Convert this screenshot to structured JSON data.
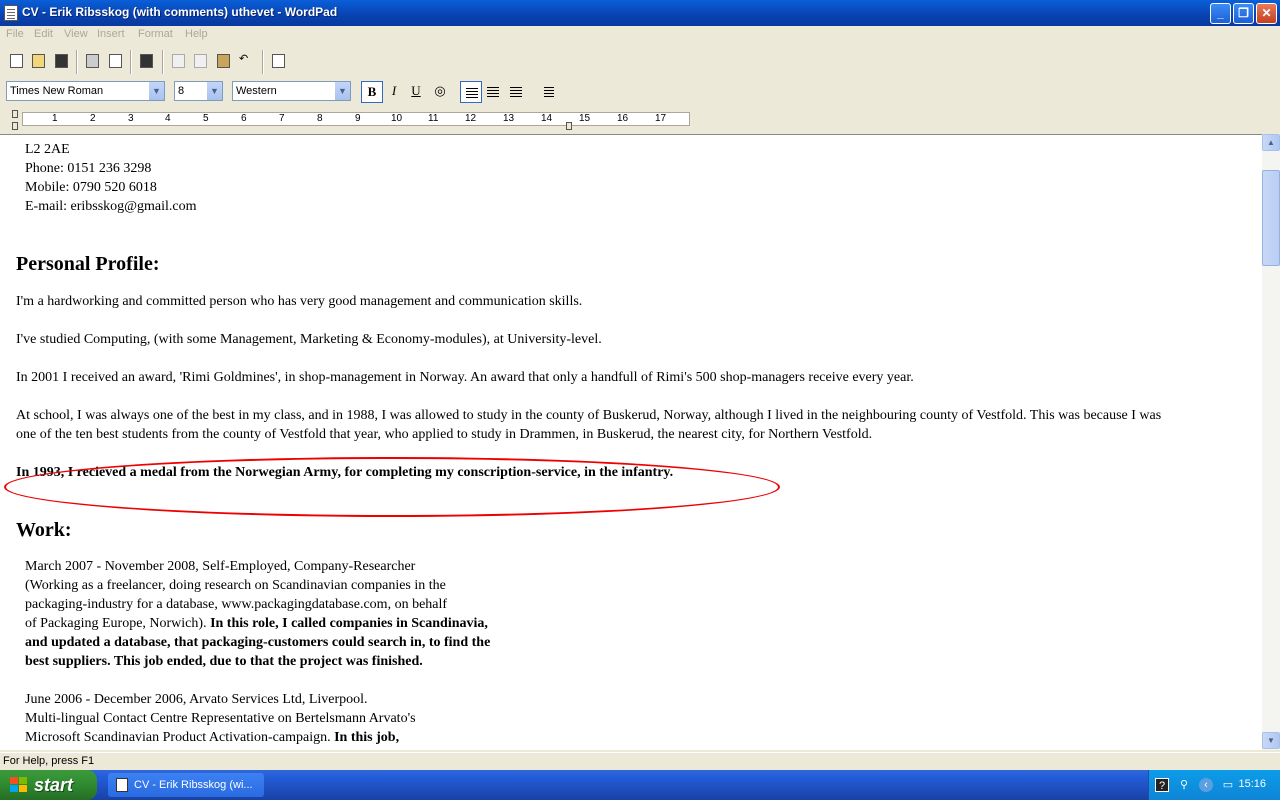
{
  "window": {
    "title": "CV - Erik Ribsskog (with comments) uthevet - WordPad"
  },
  "menu": [
    "File",
    "Edit",
    "View",
    "Insert",
    "Format",
    "Help"
  ],
  "format": {
    "font": "Times New Roman",
    "size": "8",
    "script": "Western",
    "bold_label": "B",
    "italic_label": "I",
    "underline_label": "U"
  },
  "ruler": [
    "1",
    "2",
    "3",
    "4",
    "5",
    "6",
    "7",
    "8",
    "9",
    "10",
    "11",
    "12",
    "13",
    "14",
    "15",
    "16",
    "17"
  ],
  "document": {
    "address_lines": [
      "L2 2AE",
      "Phone: 0151 236 3298",
      "Mobile: 0790 520 6018",
      "E-mail: eribsskog@gmail.com"
    ],
    "profile_heading": "Personal Profile:",
    "profile_p1": "I'm a hardworking and committed person who has very good management and communication skills.",
    "profile_p2": "I've studied Computing, (with some Management, Marketing & Economy-modules), at University-level.",
    "profile_p3": "In 2001 I received an award, 'Rimi Goldmines',  in shop-management in Norway. An award that only a handfull of Rimi's 500 shop-managers receive every year.",
    "profile_p4a": "At school, I was always one of the best in my class, and in 1988, I was allowed to study in the county of Buskerud, Norway, although I lived in the neighbouring county of Vestfold. This was because I was",
    "profile_p4b": "one of the ten best students from the county of Vestfold that year, who applied to study in Drammen, in Buskerud, the nearest city, for Northern Vestfold.",
    "profile_p5": "In 1993, I recieved a medal from the Norwegian Army, for completing my conscription-service, in the infantry.",
    "work_heading": "Work:",
    "job1": {
      "l1": "March 2007 - November 2008, Self-Employed, Company-Researcher",
      "l2": "(Working as a freelancer, doing research on Scandinavian companies in the",
      "l3": "packaging-industry for a database, www.packagingdatabase.com, on behalf",
      "l4a": "of Packaging Europe, Norwich). ",
      "l4b": "In this role, I called companies in Scandinavia,",
      "l5": "and updated a database, that packaging-customers could search in, to find the",
      "l6": "best suppliers. This job ended, due to that the project was finished."
    },
    "job2": {
      "l1": "June 2006 - December 2006, Arvato Services Ltd, Liverpool.",
      "l2": "Multi-lingual Contact Centre Representative on Bertelsmann Arvato's",
      "l3a": "Microsoft Scandinavian Product Activation-campaign. ",
      "l3b": "In this job,"
    }
  },
  "statusbar": {
    "text": "For Help, press F1"
  },
  "taskbar": {
    "start": "start",
    "task": "CV - Erik Ribsskog (wi...",
    "clock": "15:16"
  }
}
